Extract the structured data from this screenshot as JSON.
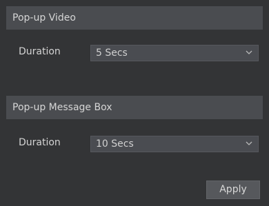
{
  "sections": [
    {
      "title": "Pop-up Video",
      "field_label": "Duration",
      "selected_value": "5 Secs"
    },
    {
      "title": "Pop-up Message Box",
      "field_label": "Duration",
      "selected_value": "10 Secs"
    }
  ],
  "apply_label": "Apply",
  "icons": {
    "dropdown": "chevron-down-icon"
  },
  "colors": {
    "background": "#333436",
    "header": "#4a4c50",
    "select_bg": "#4a4c51",
    "button_bg": "#56585c",
    "text": "#d8d8d8"
  }
}
